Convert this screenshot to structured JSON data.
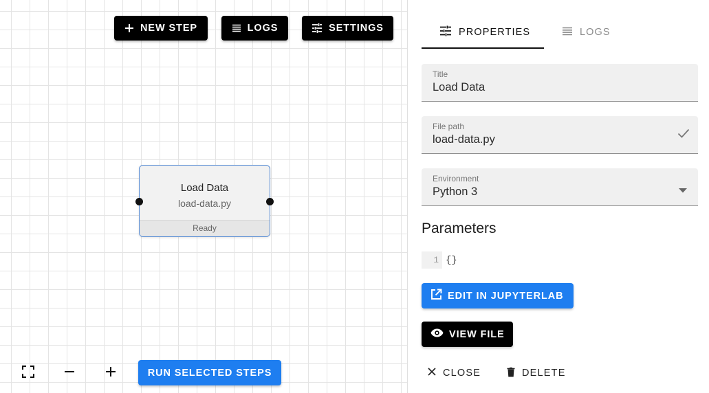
{
  "toolbar": {
    "new_step_label": "NEW STEP",
    "logs_label": "LOGS",
    "settings_label": "SETTINGS"
  },
  "node": {
    "title": "Load Data",
    "file": "load-data.py",
    "status": "Ready"
  },
  "canvas_controls": {
    "run_label": "RUN SELECTED STEPS"
  },
  "panel": {
    "tabs": [
      {
        "label": "PROPERTIES",
        "active": true
      },
      {
        "label": "LOGS",
        "active": false
      }
    ],
    "fields": {
      "title": {
        "label": "Title",
        "value": "Load Data"
      },
      "file_path": {
        "label": "File path",
        "value": "load-data.py"
      },
      "environment": {
        "label": "Environment",
        "value": "Python 3"
      }
    },
    "parameters_heading": "Parameters",
    "parameters_code": {
      "line_number": "1",
      "text": "{}"
    },
    "edit_label": "EDIT IN JUPYTERLAB",
    "view_label": "VIEW FILE",
    "close_label": "CLOSE",
    "delete_label": "DELETE"
  },
  "colors": {
    "accent_blue": "#1e7ef0",
    "button_black": "#000000",
    "node_border": "#5b8fd6"
  },
  "icons": [
    "plus-icon",
    "list-icon",
    "tune-icon",
    "fullscreen-icon",
    "minus-icon",
    "check-icon",
    "dropdown-arrow-icon",
    "open-external-icon",
    "eye-icon",
    "close-icon",
    "trash-icon"
  ]
}
